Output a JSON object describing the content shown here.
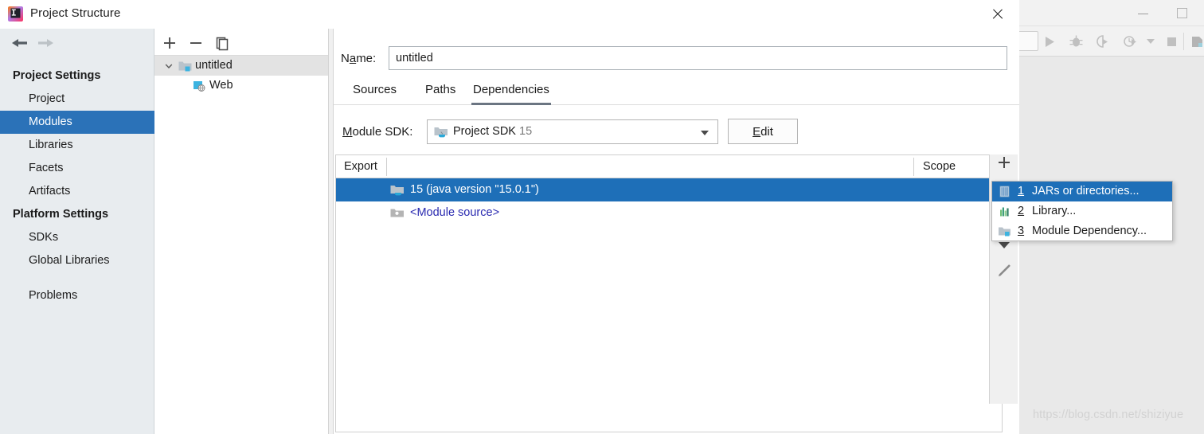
{
  "dialog": {
    "title": "Project Structure",
    "icon": "intellij-logo-icon",
    "close_label": "✕"
  },
  "nav": {
    "back_icon": "arrow-left-icon",
    "forward_icon": "arrow-right-icon",
    "sections": [
      {
        "group": "Project Settings",
        "items": [
          {
            "label": "Project",
            "selected": false
          },
          {
            "label": "Modules",
            "selected": true
          },
          {
            "label": "Libraries",
            "selected": false
          },
          {
            "label": "Facets",
            "selected": false
          },
          {
            "label": "Artifacts",
            "selected": false
          }
        ]
      },
      {
        "group": "Platform Settings",
        "items": [
          {
            "label": "SDKs",
            "selected": false
          },
          {
            "label": "Global Libraries",
            "selected": false
          }
        ]
      }
    ],
    "extra_items": [
      {
        "label": "Problems",
        "selected": false
      }
    ],
    "selected_color": "#2b72b8",
    "background": "#e8ecef"
  },
  "tree": {
    "toolbar": [
      {
        "name": "add-module-button",
        "icon": "plus-icon"
      },
      {
        "name": "remove-module-button",
        "icon": "minus-icon"
      },
      {
        "name": "copy-module-button",
        "icon": "copy-icon"
      }
    ],
    "nodes": [
      {
        "label": "untitled",
        "icon": "module-folder-icon",
        "depth": 0,
        "expanded": true,
        "selected": true
      },
      {
        "label": "Web",
        "icon": "web-facet-icon",
        "depth": 1,
        "expanded": false,
        "selected": false
      }
    ]
  },
  "main": {
    "name_label": "Name:",
    "name_label_mnemonic": "a",
    "name_value": "untitled",
    "name_placeholder": "",
    "tabs": [
      {
        "label": "Sources",
        "active": false
      },
      {
        "label": "Paths",
        "active": false
      },
      {
        "label": "Dependencies",
        "active": true
      }
    ],
    "sdk_label": "Module SDK:",
    "sdk_label_mnemonic": "M",
    "sdk_value": "Project SDK",
    "sdk_version": "15",
    "sdk_icon": "sdk-folder-icon",
    "edit_button": "Edit",
    "edit_button_mnemonic": "E",
    "table": {
      "columns": [
        "Export",
        "",
        "Scope"
      ],
      "rows": [
        {
          "export": "",
          "name": "15 (java version \"15.0.1\")",
          "scope": "",
          "icon": "jdk-folder-icon",
          "selected": true,
          "link": false
        },
        {
          "export": "",
          "name": "<Module source>",
          "scope": "",
          "icon": "module-source-icon",
          "selected": false,
          "link": true
        }
      ]
    }
  },
  "side_strip": {
    "buttons": [
      {
        "name": "add-dependency-button",
        "icon": "plus-icon"
      },
      {
        "name": "move-down-button",
        "icon": "caret-down-icon"
      },
      {
        "name": "edit-dependency-button",
        "icon": "pencil-icon"
      }
    ]
  },
  "popup_menu": {
    "items": [
      {
        "number": "1",
        "label": "JARs or directories...",
        "icon": "jar-file-icon",
        "highlighted": true
      },
      {
        "number": "2",
        "label": "Library...",
        "icon": "library-chart-icon",
        "highlighted": false
      },
      {
        "number": "3",
        "label": "Module Dependency...",
        "icon": "module-folder-icon",
        "highlighted": false
      }
    ],
    "highlight_color": "#1e6fb8"
  },
  "background_window": {
    "minimize_icon": "minimize-icon",
    "maximize_icon": "maximize-icon",
    "toolbar_icons": [
      "run-icon",
      "debug-icon",
      "run-with-coverage-icon",
      "profile-icon",
      "dropdown-caret-icon",
      "stop-icon",
      "app-icon"
    ]
  },
  "watermark": "https://blog.csdn.net/shiziyue"
}
